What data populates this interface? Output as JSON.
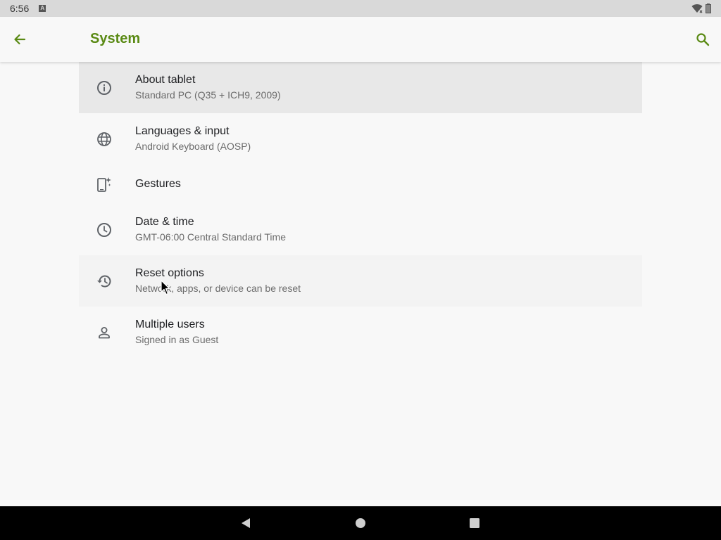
{
  "status_bar": {
    "time": "6:56",
    "notification_icon": "keyboard-a-icon",
    "wifi_icon": "wifi-icon",
    "battery_icon": "battery-icon"
  },
  "app_bar": {
    "title": "System",
    "back_icon": "back-arrow-icon",
    "search_icon": "search-icon",
    "accent_color": "#5a8a14"
  },
  "settings": {
    "items": [
      {
        "title": "About tablet",
        "summary": "Standard PC (Q35 + ICH9, 2009)",
        "icon": "info-icon"
      },
      {
        "title": "Languages & input",
        "summary": "Android Keyboard (AOSP)",
        "icon": "globe-icon"
      },
      {
        "title": "Gestures",
        "icon": "gestures-icon"
      },
      {
        "title": "Date & time",
        "summary": "GMT-06:00 Central Standard Time",
        "icon": "clock-icon"
      },
      {
        "title": "Reset options",
        "summary": "Network, apps, or device can be reset",
        "icon": "history-icon"
      },
      {
        "title": "Multiple users",
        "summary": "Signed in as Guest",
        "icon": "person-icon"
      }
    ]
  },
  "nav_bar": {
    "back_icon": "nav-back-icon",
    "home_icon": "nav-home-icon",
    "recents_icon": "nav-recents-icon"
  }
}
